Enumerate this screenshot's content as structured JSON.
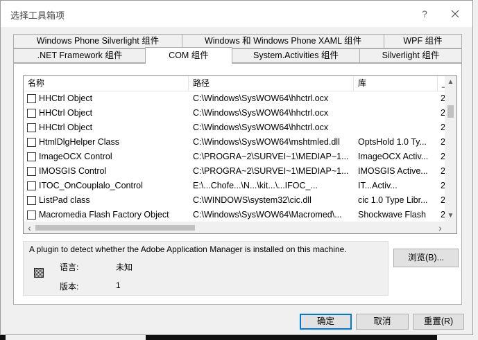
{
  "window": {
    "title": "选择工具箱项",
    "help_glyph": "?"
  },
  "tabs": {
    "row1": [
      {
        "label": "Windows Phone Silverlight 组件"
      },
      {
        "label": "Windows 和 Windows Phone XAML 组件"
      },
      {
        "label": "WPF 组件"
      }
    ],
    "row2": [
      {
        "label": ".NET Framework 组件"
      },
      {
        "label": "COM 组件",
        "active": true
      },
      {
        "label": "System.Activities 组件"
      },
      {
        "label": "Silverlight 组件"
      }
    ]
  },
  "list": {
    "columns": {
      "name": "名称",
      "path": "路径",
      "library": "库",
      "extra": "_"
    },
    "rows": [
      {
        "name": "HHCtrl Object",
        "path": "C:\\Windows\\SysWOW64\\hhctrl.ocx",
        "library": "",
        "extra": "2"
      },
      {
        "name": "HHCtrl Object",
        "path": "C:\\Windows\\SysWOW64\\hhctrl.ocx",
        "library": "",
        "extra": "2"
      },
      {
        "name": "HHCtrl Object",
        "path": "C:\\Windows\\SysWOW64\\hhctrl.ocx",
        "library": "",
        "extra": "2"
      },
      {
        "name": "HtmlDlgHelper Class",
        "path": "C:\\Windows\\SysWOW64\\mshtmled.dll",
        "library": "OptsHold 1.0 Ty...",
        "extra": "2"
      },
      {
        "name": "ImageOCX Control",
        "path": "C:\\PROGRA~2\\SURVEI~1\\MEDIAP~1...",
        "library": "ImageOCX Activ...",
        "extra": "2"
      },
      {
        "name": "IMOSGIS Control",
        "path": "C:\\PROGRA~2\\SURVEI~1\\MEDIAP~1...",
        "library": "IMOSGIS Active...",
        "extra": "2"
      },
      {
        "name": "ITOC_OnCouplalo_Control",
        "path": "E:\\...Chofe...\\N...\\kit...\\...IFOC_...",
        "library": "IT...Activ...",
        "extra": "2"
      },
      {
        "name": "ListPad class",
        "path": "C:\\WINDOWS\\system32\\cic.dll",
        "library": "cic 1.0 Type Libr...",
        "extra": "2"
      },
      {
        "name": "Macromedia Flash Factory Object",
        "path": "C:\\Windows\\SysWOW64\\Macromed\\...",
        "library": "Shockwave Flash",
        "extra": "2"
      }
    ],
    "scroll": {
      "up": "▲",
      "down": "▼",
      "left": "‹",
      "right": "›"
    }
  },
  "info": {
    "description": "A plugin to detect whether the Adobe Application Manager is installed on this machine.",
    "language_label": "语言:",
    "language_value": "未知",
    "version_label": "版本:",
    "version_value": "1"
  },
  "buttons": {
    "browse": "浏览(B)...",
    "ok": "确定",
    "cancel": "取消",
    "reset": "重置(R)"
  }
}
